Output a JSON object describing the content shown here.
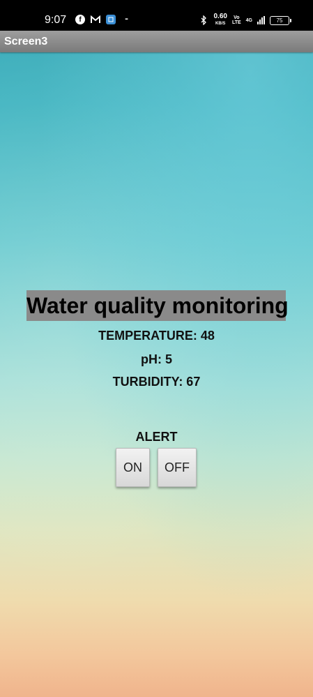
{
  "status_bar": {
    "time": "9:07",
    "network_speed": "0.60",
    "network_speed_unit": "KB/S",
    "volte_top": "Vo",
    "volte_bottom": "LTE",
    "network_type": "4G",
    "battery_level": "75",
    "icons": [
      "facebook-icon",
      "gmail-icon",
      "app-icon",
      "notification-dots-icon",
      "bluetooth-icon",
      "signal-icon",
      "battery-icon"
    ]
  },
  "title_bar": {
    "title": "Screen3"
  },
  "main": {
    "heading": "Water quality monitoring",
    "temperature": "TEMPERATURE: 48",
    "ph": "pH: 5",
    "turbidity": "TURBIDITY: 67",
    "alert_label": "ALERT",
    "on_button": "ON",
    "off_button": "OFF"
  }
}
